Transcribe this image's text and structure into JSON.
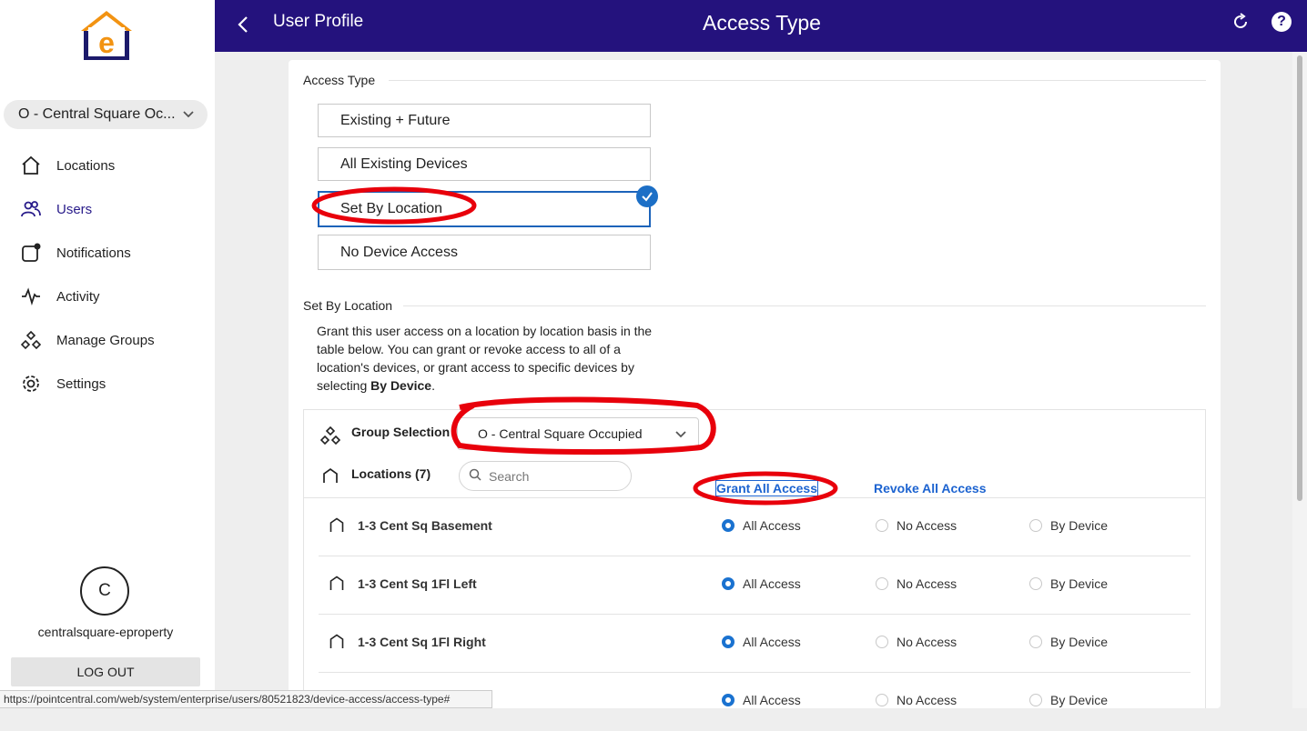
{
  "sidebar": {
    "org_name": "O - Central Square Oc...",
    "items": [
      {
        "label": "Locations",
        "icon": "home-icon"
      },
      {
        "label": "Users",
        "icon": "users-icon",
        "active": true
      },
      {
        "label": "Notifications",
        "icon": "notification-icon"
      },
      {
        "label": "Activity",
        "icon": "activity-icon"
      },
      {
        "label": "Manage Groups",
        "icon": "groups-icon"
      },
      {
        "label": "Settings",
        "icon": "gear-icon"
      }
    ],
    "avatar_initial": "C",
    "username": "centralsquare-eproperty",
    "logout_label": "LOG OUT"
  },
  "header": {
    "back_label": "User Profile",
    "title": "Access Type"
  },
  "access_type": {
    "heading": "Access Type",
    "options": [
      "Existing + Future",
      "All Existing Devices",
      "Set By Location",
      "No Device Access"
    ],
    "selected": "Set By Location"
  },
  "set_by_location": {
    "heading": "Set By Location",
    "description_prefix": "Grant this user access on a location by location basis in the table below. You can grant or revoke access to all of a location's devices, or grant access to specific devices by selecting ",
    "description_bold": "By Device",
    "description_suffix": ".",
    "group_selection_label": "Group Selection",
    "group_selection_value": "O - Central Square Occupied",
    "locations_label": "Locations (7)",
    "search_placeholder": "Search",
    "grant_all_label": "Grant All Access",
    "revoke_all_label": "Revoke All Access",
    "radio_labels": [
      "All Access",
      "No Access",
      "By Device"
    ],
    "rows": [
      {
        "name": "1-3 Cent Sq Basement",
        "selected": "All Access"
      },
      {
        "name": "1-3 Cent Sq 1Fl Left",
        "selected": "All Access"
      },
      {
        "name": "1-3 Cent Sq 1Fl Right",
        "selected": "All Access"
      },
      {
        "name": "",
        "selected": "All Access"
      }
    ]
  },
  "status_bar_url": "https://pointcentral.com/web/system/enterprise/users/80521823/device-access/access-type#",
  "colors": {
    "header_bg": "#24127d",
    "accent": "#1c63d0",
    "annotation": "#e8000b"
  }
}
